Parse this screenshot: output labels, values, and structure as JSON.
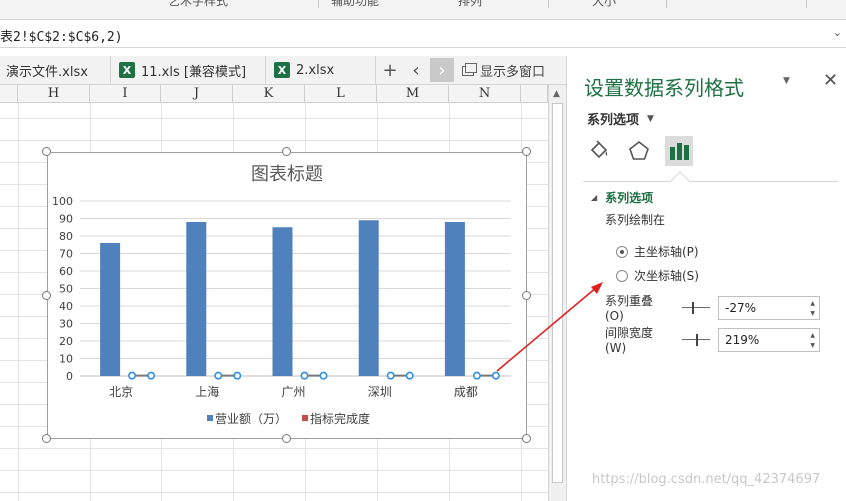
{
  "ribbon": {
    "items": [
      "艺术字样式",
      "辅助功能",
      "排列",
      "大小"
    ]
  },
  "formula_bar": {
    "text": "表2!$C$2:$C$6,2)",
    "expand_icon": "chevron-down-icon"
  },
  "tabs": {
    "items": [
      {
        "label": "演示文件.xlsx",
        "icon": "excel-icon"
      },
      {
        "label": "11.xls  [兼容模式]",
        "icon": "excel-icon"
      },
      {
        "label": "2.xlsx",
        "icon": "excel-icon"
      }
    ],
    "add_icon": "plus-icon",
    "prev_icon": "chevron-left-icon",
    "next_icon": "chevron-right-icon",
    "multi_window_label": "显示多窗口"
  },
  "grid": {
    "columns": [
      "H",
      "I",
      "J",
      "K",
      "L",
      "M",
      "N"
    ]
  },
  "chart_data": {
    "type": "bar",
    "title": "图表标题",
    "categories": [
      "北京",
      "上海",
      "广州",
      "深圳",
      "成都"
    ],
    "series": [
      {
        "name": "营业额（万）",
        "values": [
          76,
          88,
          85,
          89,
          88
        ],
        "color": "#4f81bd",
        "kind": "bar"
      },
      {
        "name": "指标完成度",
        "values": [
          0.2,
          0.2,
          0.2,
          0.2,
          0.2
        ],
        "color": "#c0504d",
        "kind": "secondary-selected"
      }
    ],
    "yticks": [
      "100",
      "90",
      "80",
      "70",
      "60",
      "50",
      "40",
      "30",
      "20",
      "10",
      "0"
    ],
    "ylim": [
      0,
      100
    ],
    "xlabel": "",
    "ylabel": "",
    "grid": true,
    "legend_position": "bottom"
  },
  "panel": {
    "title": "设置数据系列格式",
    "options_label": "系列选项",
    "section_label": "系列选项",
    "plot_on_label": "系列绘制在",
    "primary_axis_label": "主坐标轴(P)",
    "secondary_axis_label": "次坐标轴(S)",
    "primary_checked": true,
    "overlap_label": "系列重叠(O)",
    "overlap_value": "-27%",
    "gap_label": "间隙宽度(W)",
    "gap_value": "219%",
    "icons": [
      "fill-bucket-icon",
      "pentagon-icon",
      "bar-chart-icon"
    ]
  },
  "watermark": "https://blog.csdn.net/qq_42374697",
  "colors": {
    "accent_green": "#1e7145",
    "bar_blue": "#4f81bd",
    "series_red": "#c0504d",
    "arrow_red": "#e02020"
  }
}
